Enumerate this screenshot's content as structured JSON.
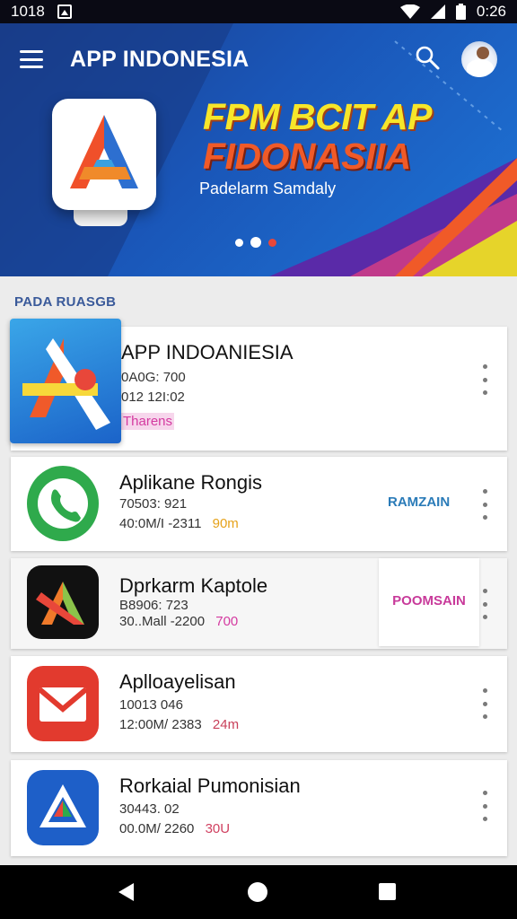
{
  "status_bar": {
    "left_text": "1018",
    "time": "0:26"
  },
  "toolbar": {
    "title": "APP INDONESIA"
  },
  "promo": {
    "headline_line1": "FPM BCIT AP",
    "headline_line2": "FIDONASIIA",
    "subtitle": "Padelarm Samdaly"
  },
  "section": {
    "label": "PADA RUASGB"
  },
  "apps": [
    {
      "title": "APP INDOANIESIA",
      "line1": "0A0G: 700",
      "line2": "012 12I:02",
      "tag": "Tharens",
      "tag_color": "#d43aa0"
    },
    {
      "title": "Aplikane Rongis",
      "line1": "70503: 921",
      "line2": "40:0M/I -2311",
      "tag": "90m",
      "tag_color": "#e6a21a",
      "action": "RAMZAIN",
      "action_color": "#2a7bb8"
    },
    {
      "title": "Dprkarm Kaptole",
      "line1": "B8906: 723",
      "line2": "30..Mall -2200",
      "tag": "700",
      "tag_color": "#d43aa0",
      "action": "POOMSAIN",
      "action_color": "#c83a9a"
    },
    {
      "title": "Aplloayelisan",
      "line1": "10013 046",
      "line2": "12:00M/ 2383",
      "tag": "24m",
      "tag_color": "#c8405a"
    },
    {
      "title": "Rorkaial Pumonisian",
      "line1": "30443. 02",
      "line2": "00.0M/ 2260",
      "tag": "30U",
      "tag_color": "#d04060"
    }
  ],
  "colors": {
    "hero_blue": "#1a56b8",
    "accent_yellow": "#f7e62a",
    "accent_orange": "#f05a28"
  }
}
